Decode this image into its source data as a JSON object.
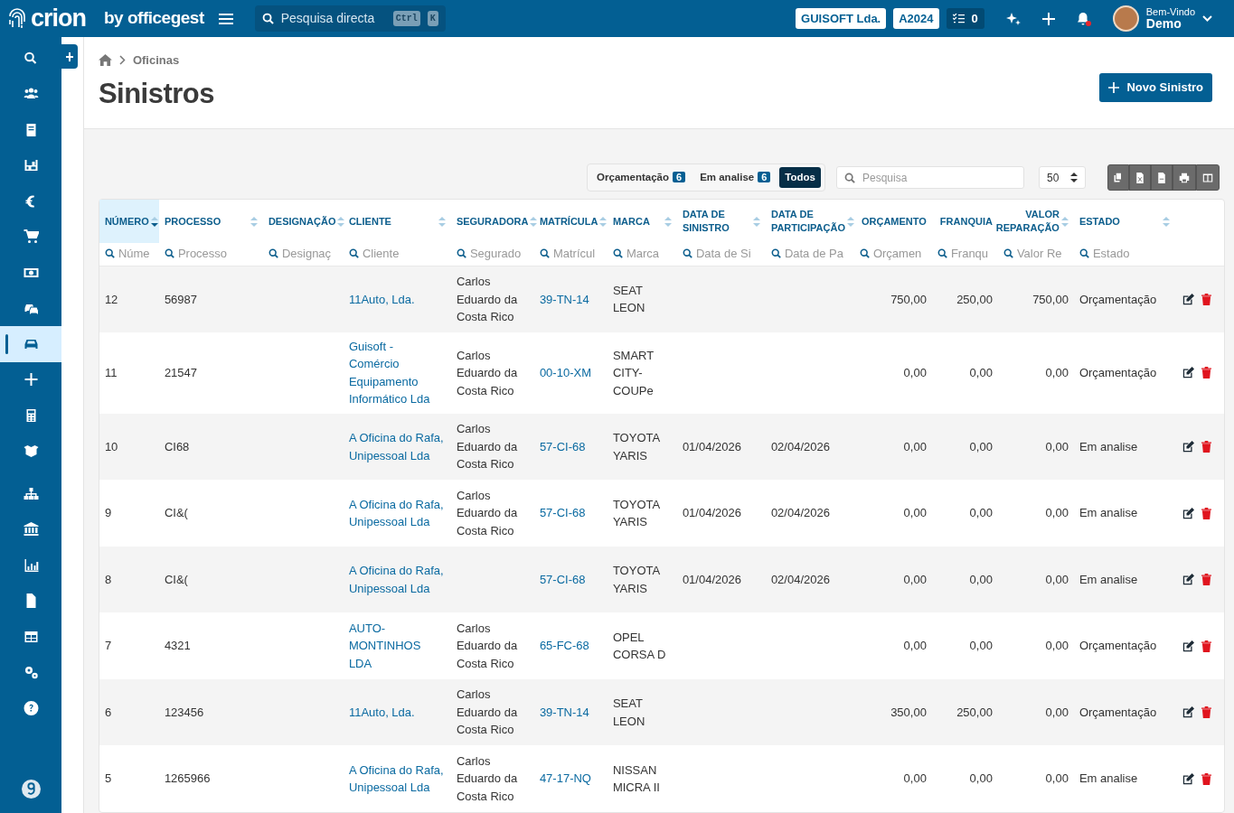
{
  "topbar": {
    "logo": "crion",
    "logo_suffix": "by officegest",
    "search": {
      "placeholder": "Pesquisa directa",
      "keys": [
        "Ctrl",
        "K"
      ]
    },
    "company": "GUISOFT Lda.",
    "year": "A2024",
    "tasks": "0",
    "notification_unread": true,
    "greeting": "Bem-Vindo",
    "user": "Demo"
  },
  "sidebar": {
    "items": [
      {
        "selected": false
      },
      {
        "selected": false
      },
      {
        "selected": false
      },
      {
        "selected": false
      },
      {
        "selected": false
      },
      {
        "selected": false
      },
      {
        "selected": false
      },
      {
        "selected": false
      },
      {
        "selected": true
      },
      {
        "selected": false
      },
      {
        "selected": false
      },
      {
        "selected": false
      },
      {
        "selected": false
      },
      {
        "selected": false
      },
      {
        "selected": false
      },
      {
        "selected": false
      },
      {
        "selected": false
      },
      {
        "selected": false
      },
      {
        "selected": false
      }
    ]
  },
  "breadcrumb": [
    "Oficinas"
  ],
  "page_title": "Sinistros",
  "new_button": "Novo Sinistro",
  "filters": [
    {
      "label": "Orçamentação",
      "count": "6",
      "selected": false
    },
    {
      "label": "Em analise",
      "count": "6",
      "selected": false
    },
    {
      "label": "Todos",
      "selected": true
    }
  ],
  "search": {
    "placeholder": "Pesquisa"
  },
  "page_size": "50",
  "table": {
    "columns": [
      {
        "label": "NÚMERO",
        "filter": "Núme",
        "sorted": true,
        "kind": "text"
      },
      {
        "label": "PROCESSO",
        "filter": "Processo",
        "sorted": false,
        "kind": "text"
      },
      {
        "label": "DESIGNAÇÃO",
        "filter": "Designaç",
        "sorted": false,
        "kind": "text"
      },
      {
        "label": "CLIENTE",
        "filter": "Cliente",
        "sorted": false,
        "kind": "link"
      },
      {
        "label": "SEGURADORA",
        "filter": "Segurado",
        "sorted": false,
        "kind": "text"
      },
      {
        "label": "MATRÍCULA",
        "filter": "Matrícul",
        "sorted": false,
        "kind": "link"
      },
      {
        "label": "MARCA",
        "filter": "Marca",
        "sorted": false,
        "kind": "text"
      },
      {
        "label": "DATA DE SINISTRO",
        "filter": "Data de Si",
        "sorted": false,
        "kind": "text"
      },
      {
        "label": "DATA DE PARTICIPAÇÃO",
        "filter": "Data de Pa",
        "sorted": false,
        "kind": "text"
      },
      {
        "label": "ORÇAMENTO",
        "filter": "Orçamen",
        "sorted": false,
        "kind": "money"
      },
      {
        "label": "FRANQUIA",
        "filter": "Franqu",
        "sorted": false,
        "kind": "money"
      },
      {
        "label": "VALOR REPARAÇÃO",
        "filter": "Valor Re",
        "sorted": false,
        "kind": "money"
      },
      {
        "label": "ESTADO",
        "filter": "Estado",
        "sorted": false,
        "kind": "text"
      }
    ],
    "rows": [
      [
        "12",
        "56987",
        null,
        "11Auto, Lda.",
        "Carlos Eduardo da Costa Rico",
        "39-TN-14",
        "SEAT LEON",
        null,
        null,
        "750,00",
        "250,00",
        "750,00",
        "Orçamentação"
      ],
      [
        "11",
        "21547",
        null,
        "Guisoft - Comércio Equipamento Informático Lda",
        "Carlos Eduardo da Costa Rico",
        "00-10-XM",
        "SMART CITY-COUPe",
        null,
        null,
        "0,00",
        "0,00",
        "0,00",
        "Orçamentação"
      ],
      [
        "10",
        "CI68",
        null,
        "A Oficina do Rafa, Unipessoal Lda",
        "Carlos Eduardo da Costa Rico",
        "57-CI-68",
        "TOYOTA YARIS",
        "01/04/2026",
        "02/04/2026",
        "0,00",
        "0,00",
        "0,00",
        "Em analise"
      ],
      [
        "9",
        "CI&(",
        null,
        "A Oficina do Rafa, Unipessoal Lda",
        "Carlos Eduardo da Costa Rico",
        "57-CI-68",
        "TOYOTA YARIS",
        "01/04/2026",
        "02/04/2026",
        "0,00",
        "0,00",
        "0,00",
        "Em analise"
      ],
      [
        "8",
        "CI&(",
        null,
        "A Oficina do Rafa, Unipessoal Lda",
        null,
        "57-CI-68",
        "TOYOTA YARIS",
        "01/04/2026",
        "02/04/2026",
        "0,00",
        "0,00",
        "0,00",
        "Em analise"
      ],
      [
        "7",
        "4321",
        null,
        "AUTO-MONTINHOS LDA",
        "Carlos Eduardo da Costa Rico",
        "65-FC-68",
        "OPEL CORSA D",
        null,
        null,
        "0,00",
        "0,00",
        "0,00",
        "Orçamentação"
      ],
      [
        "6",
        "123456",
        null,
        "11Auto, Lda.",
        "Carlos Eduardo da Costa Rico",
        "39-TN-14",
        "SEAT LEON",
        null,
        null,
        "350,00",
        "250,00",
        "0,00",
        "Orçamentação"
      ],
      [
        "5",
        "1265966",
        null,
        "A Oficina do Rafa, Unipessoal Lda",
        "Carlos Eduardo da Costa Rico",
        "47-17-NQ",
        "NISSAN MICRA II",
        null,
        null,
        "0,00",
        "0,00",
        "0,00",
        "Em analise"
      ]
    ]
  }
}
